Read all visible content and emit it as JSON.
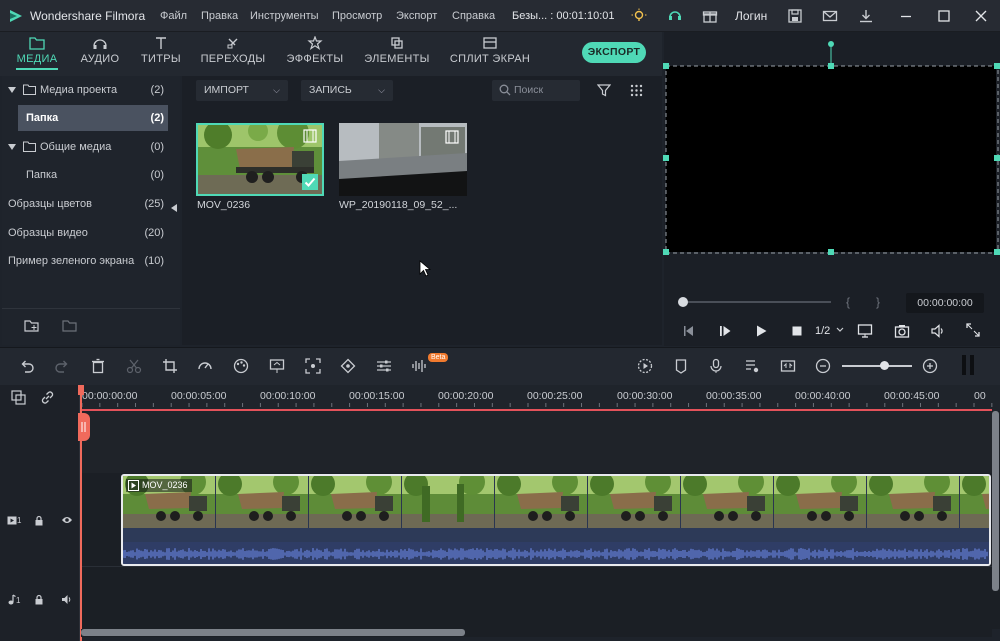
{
  "app": {
    "title": "Wondershare Filmora",
    "project_info": "Безы... : 00:01:10:01",
    "login": "Логин"
  },
  "menu": [
    "Файл",
    "Правка",
    "Инструменты",
    "Просмотр",
    "Экспорт",
    "Справка"
  ],
  "tabs": [
    {
      "label": "МЕДИА",
      "icon": "folder-icon"
    },
    {
      "label": "АУДИО",
      "icon": "music-note-icon"
    },
    {
      "label": "ТИТРЫ",
      "icon": "text-icon"
    },
    {
      "label": "ПЕРЕХОДЫ",
      "icon": "transition-icon"
    },
    {
      "label": "ЭФФЕКТЫ",
      "icon": "effects-icon"
    },
    {
      "label": "ЭЛЕМЕНТЫ",
      "icon": "elements-icon"
    },
    {
      "label": "СПЛИТ ЭКРАН",
      "icon": "split-screen-icon"
    }
  ],
  "export_label": "ЭКСПОРТ",
  "sidebar": {
    "items": [
      {
        "label": "Медиа проекта",
        "count": "(2)"
      },
      {
        "label": "Папка",
        "count": "(2)"
      },
      {
        "label": "Общие медиа",
        "count": "(0)"
      },
      {
        "label": "Папка",
        "count": "(0)"
      },
      {
        "label": "Образцы цветов",
        "count": "(25)"
      },
      {
        "label": "Образцы видео",
        "count": "(20)"
      },
      {
        "label": "Пример зеленого экрана",
        "count": "(10)"
      }
    ]
  },
  "media": {
    "import_label": "ИМПОРТ",
    "record_label": "ЗАПИСЬ",
    "search_placeholder": "Поиск",
    "items": [
      {
        "name": "MOV_0236"
      },
      {
        "name": "WP_20190118_09_52_..."
      }
    ]
  },
  "preview": {
    "timecode": "00:00:00:00",
    "ratio": "1/2"
  },
  "timeline": {
    "ticks": [
      "00:00:00:00",
      "00:00:05:00",
      "00:00:10:00",
      "00:00:15:00",
      "00:00:20:00",
      "00:00:25:00",
      "00:00:30:00",
      "00:00:35:00",
      "00:00:40:00",
      "00:00:45:00",
      "00"
    ],
    "clip_name": "MOV_0236",
    "beta_badge": "Beta",
    "video_track": "1",
    "audio_track": "1"
  },
  "colors": {
    "accent": "#4fd9b6",
    "playhead": "#f06a5c",
    "selected_row": "#4a5260"
  }
}
